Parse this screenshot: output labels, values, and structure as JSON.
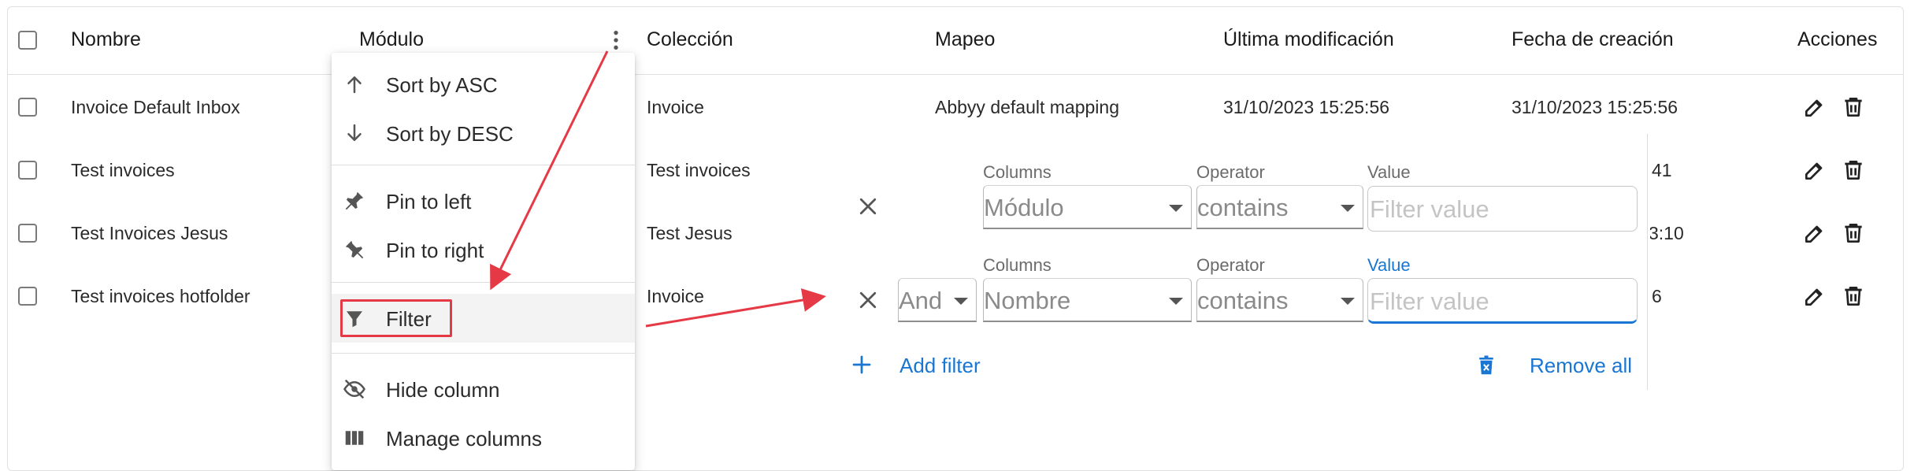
{
  "table": {
    "columns": {
      "name": "Nombre",
      "module": "Módulo",
      "collection": "Colección",
      "mapping": "Mapeo",
      "modified": "Última modificación",
      "created": "Fecha de creación",
      "actions": "Acciones"
    },
    "rows": [
      {
        "name": "Invoice Default Inbox",
        "collection": "Invoice",
        "mapping": "Abbyy default mapping",
        "modified": "31/10/2023 15:25:56",
        "created": "31/10/2023 15:25:56"
      },
      {
        "name": "Test invoices",
        "collection": "Test invoices",
        "created_partial": "41"
      },
      {
        "name": "Test Invoices Jesus",
        "collection": "Test Jesus",
        "created_partial": "3:10"
      },
      {
        "name": "Test invoices hotfolder",
        "collection": "Invoice",
        "created_partial": "6"
      }
    ]
  },
  "column_menu": {
    "items": {
      "sort_asc": "Sort by ASC",
      "sort_desc": "Sort by DESC",
      "pin_left": "Pin to left",
      "pin_right": "Pin to right",
      "filter": "Filter",
      "hide_column": "Hide column",
      "manage_columns": "Manage columns"
    }
  },
  "filter_panel": {
    "labels": {
      "columns": "Columns",
      "operator": "Operator",
      "value": "Value"
    },
    "filters": [
      {
        "column": "Módulo",
        "operator": "contains",
        "placeholder": "Filter value"
      },
      {
        "logic": "And",
        "column": "Nombre",
        "operator": "contains",
        "placeholder": "Filter value"
      }
    ],
    "add_filter": "Add filter",
    "remove_all": "Remove all"
  },
  "colors": {
    "accent": "#1976d2",
    "annotation": "#e53946"
  }
}
